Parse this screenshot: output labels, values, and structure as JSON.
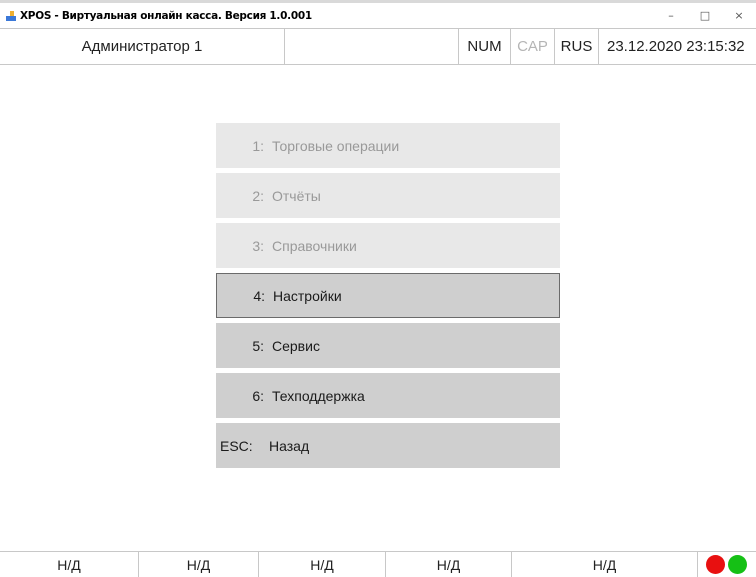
{
  "window": {
    "title": "XPOS - Виртуальная онлайн касса. Версия 1.0.001",
    "icon": "app-icon",
    "controls": {
      "minimize": "–",
      "maximize": "□",
      "close": "×"
    }
  },
  "status": {
    "user": "Администратор 1",
    "num": "NUM",
    "cap": "CAP",
    "lang": "RUS",
    "datetime": "23.12.2020 23:15:32"
  },
  "menu": {
    "items": [
      {
        "key": "1:",
        "label": "Торговые операции",
        "state": "disabled"
      },
      {
        "key": "2:",
        "label": "Отчёты",
        "state": "disabled"
      },
      {
        "key": "3:",
        "label": "Справочники",
        "state": "disabled"
      },
      {
        "key": "4:",
        "label": "Настройки",
        "state": "selected"
      },
      {
        "key": "5:",
        "label": "Сервис",
        "state": "enabled"
      },
      {
        "key": "6:",
        "label": "Техподдержка",
        "state": "enabled"
      },
      {
        "key": "ESC:",
        "label": "Назад",
        "state": "enabled"
      }
    ]
  },
  "footer": {
    "cells": [
      "Н/Д",
      "Н/Д",
      "Н/Д",
      "Н/Д",
      "Н/Д"
    ],
    "indicators": [
      {
        "name": "red-status-indicator",
        "color": "#e81010"
      },
      {
        "name": "green-status-indicator",
        "color": "#15c015"
      }
    ]
  }
}
